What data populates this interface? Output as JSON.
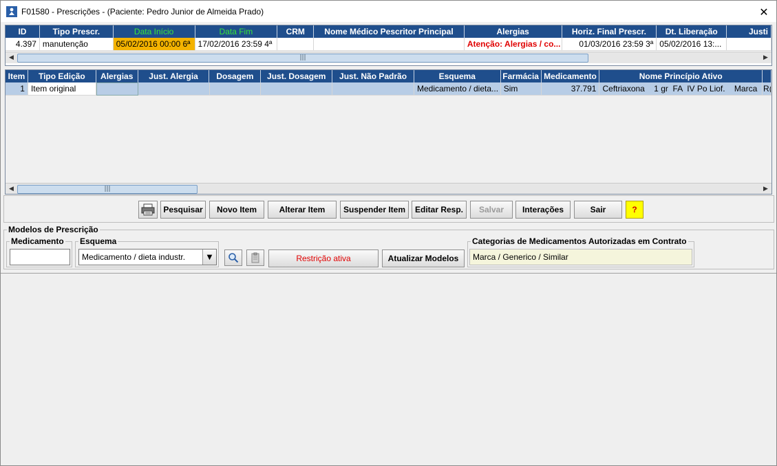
{
  "window": {
    "title": "F01580 - Prescrições - (Paciente: Pedro Junior de Almeida Prado)",
    "close_glyph": "✕"
  },
  "prescriptions": {
    "columns": [
      "ID",
      "Tipo Prescr.",
      "Data Início",
      "Data Fim",
      "CRM",
      "Nome Médico Pescritor Principal",
      "Alergias",
      "Horiz. Final Prescr.",
      "Dt. Liberação",
      "Justi"
    ],
    "rows": [
      {
        "id": "4.397",
        "tipo": "manutenção",
        "data_inicio": "05/02/2016 00:00 6ª",
        "data_fim": "17/02/2016 23:59 4ª",
        "crm": "",
        "nome_medico": "",
        "alergias": "Atenção: Alergias / co...",
        "horiz_final": "01/03/2016 23:59 3ª",
        "dt_liberacao": "05/02/2016 13:...",
        "justi": ""
      }
    ],
    "scroll_thumb_glyph": "|||"
  },
  "items": {
    "columns": [
      "Item",
      "Tipo Edição",
      "Alergias",
      "Just. Alergia",
      "Dosagem",
      "Just. Dosagem",
      "Just. Não Padrão",
      "Esquema",
      "Farmácia",
      "Medicamento",
      "Nome Princípio Ativo"
    ],
    "rows": [
      {
        "item": "1",
        "tipo_edicao": "Item original",
        "alergias": "",
        "just_alergia": "",
        "dosagem": "",
        "just_dosagem": "",
        "just_nao_padrao": "",
        "esquema": "Medicamento / dieta...",
        "farmacia": "Sim",
        "medicamento": "37.791",
        "principio_ativo": "Ceftriaxona    1 gr  FA  IV Po Liof.    Marca",
        "extra": "R("
      }
    ],
    "scroll_thumb_glyph": "|||"
  },
  "toolbar": {
    "pesquisar": "Pesquisar",
    "novo_item": "Novo Item",
    "alterar_item": "Alterar Item",
    "suspender_item": "Suspender Item",
    "editar_resp": "Editar Resp.",
    "salvar": "Salvar",
    "interacoes": "Interações",
    "sair": "Sair",
    "help": "?"
  },
  "modelos": {
    "legend": "Modelos de Prescrição",
    "medicamento_label": "Medicamento",
    "medicamento_value": "",
    "esquema_label": "Esquema",
    "esquema_value": "Medicamento / dieta industr.",
    "restricao_label": "Restrição ativa",
    "atualizar_label": "Atualizar Modelos",
    "categorias_label": "Categorias de Medicamentos Autorizadas em Contrato",
    "categorias_value": "Marca / Generico / Similar"
  },
  "colors": {
    "header_bg": "#1f4e8c",
    "highlight_date": "#f4b300",
    "alert_red": "#e00000",
    "green_header": "#39e639"
  }
}
